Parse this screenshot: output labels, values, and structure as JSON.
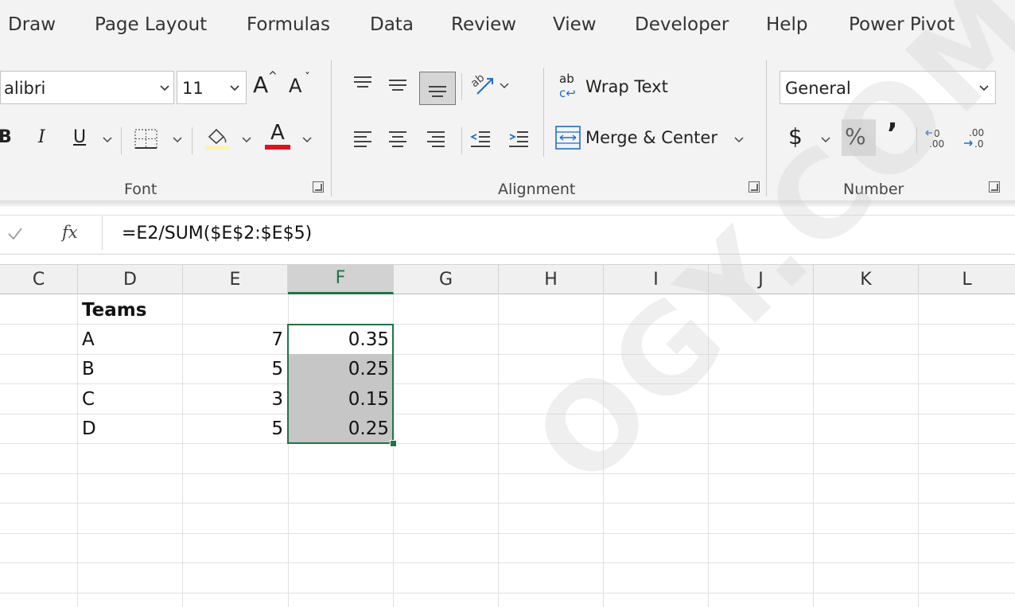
{
  "menu": [
    "Draw",
    "Page Layout",
    "Formulas",
    "Data",
    "Review",
    "View",
    "Developer",
    "Help",
    "Power Pivot"
  ],
  "font": {
    "name": "alibri",
    "size": "11",
    "grow": "A",
    "shrink": "A",
    "bold": "B",
    "italic": "I",
    "underline": "U",
    "font_color": "A",
    "group_label": "Font"
  },
  "alignment": {
    "wrap_icon": "ab",
    "wrap_text": "Wrap Text",
    "merge_center": "Merge & Center",
    "group_label": "Alignment"
  },
  "number": {
    "format": "General",
    "currency": "$",
    "percent": "%",
    "comma": "’",
    "group_label": "Number"
  },
  "formula_bar": {
    "fx": "fx",
    "formula": "=E2/SUM($E$2:$E$5)"
  },
  "sheet": {
    "columns": [
      "C",
      "D",
      "E",
      "F",
      "G",
      "H",
      "I",
      "J",
      "K",
      "L"
    ],
    "header": "Teams",
    "rows": [
      {
        "team": "A",
        "count": "7",
        "share": "0.35"
      },
      {
        "team": "B",
        "count": "5",
        "share": "0.25"
      },
      {
        "team": "C",
        "count": "3",
        "share": "0.15"
      },
      {
        "team": "D",
        "count": "5",
        "share": "0.25"
      }
    ]
  },
  "watermark": "OGY.COM",
  "colors": {
    "accent": "#217346",
    "selection": "#c6c6c6",
    "font_color_bar": "#e3101b",
    "highlight_bar": "#fff2b3"
  }
}
